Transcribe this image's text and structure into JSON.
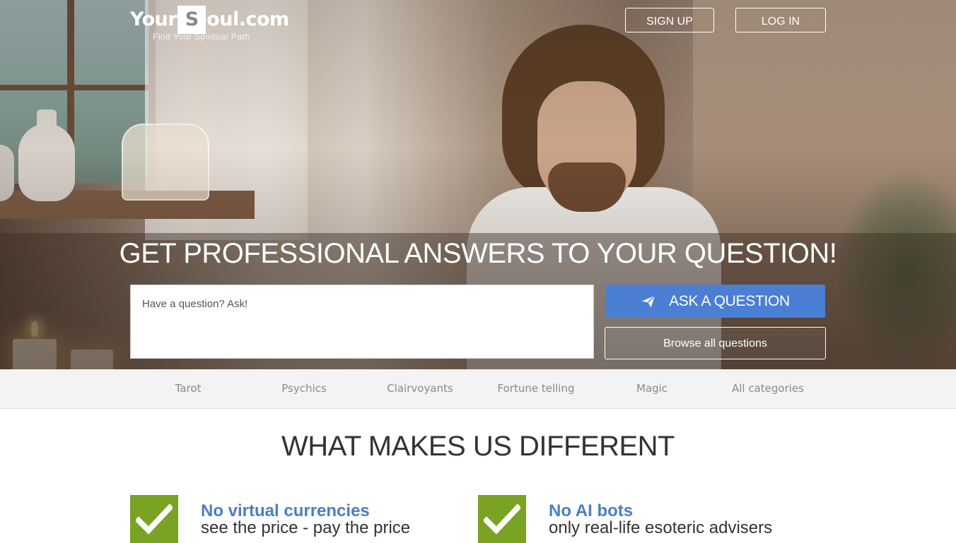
{
  "header": {
    "logo_prefix": "Your",
    "logo_letter": "S",
    "logo_suffix": "oul.com",
    "tagline": "Find Your Spiritual Path",
    "signup_label": "SIGN UP",
    "login_label": "LOG IN"
  },
  "hero": {
    "headline": "GET PROFESSIONAL ANSWERS TO YOUR QUESTION!",
    "question_placeholder": "Have a question? Ask!",
    "ask_label": "ASK A QUESTION",
    "ask_icon": "paper-plane-icon",
    "browse_label": "Browse all questions",
    "accent_color": "#4a7fd4"
  },
  "categories": [
    "Tarot",
    "Psychics",
    "Clairvoyants",
    "Fortune telling",
    "Magic",
    "All categories"
  ],
  "section": {
    "title": "WHAT MAKES US DIFFERENT",
    "features": [
      {
        "icon": "checkmark-icon",
        "title": "No virtual currencies",
        "subtitle": "see the price - pay the price"
      },
      {
        "icon": "checkmark-icon",
        "title": "No AI bots",
        "subtitle": "only real-life esoteric advisers"
      }
    ],
    "check_color": "#7aa323",
    "title_color": "#4a7fc0"
  }
}
